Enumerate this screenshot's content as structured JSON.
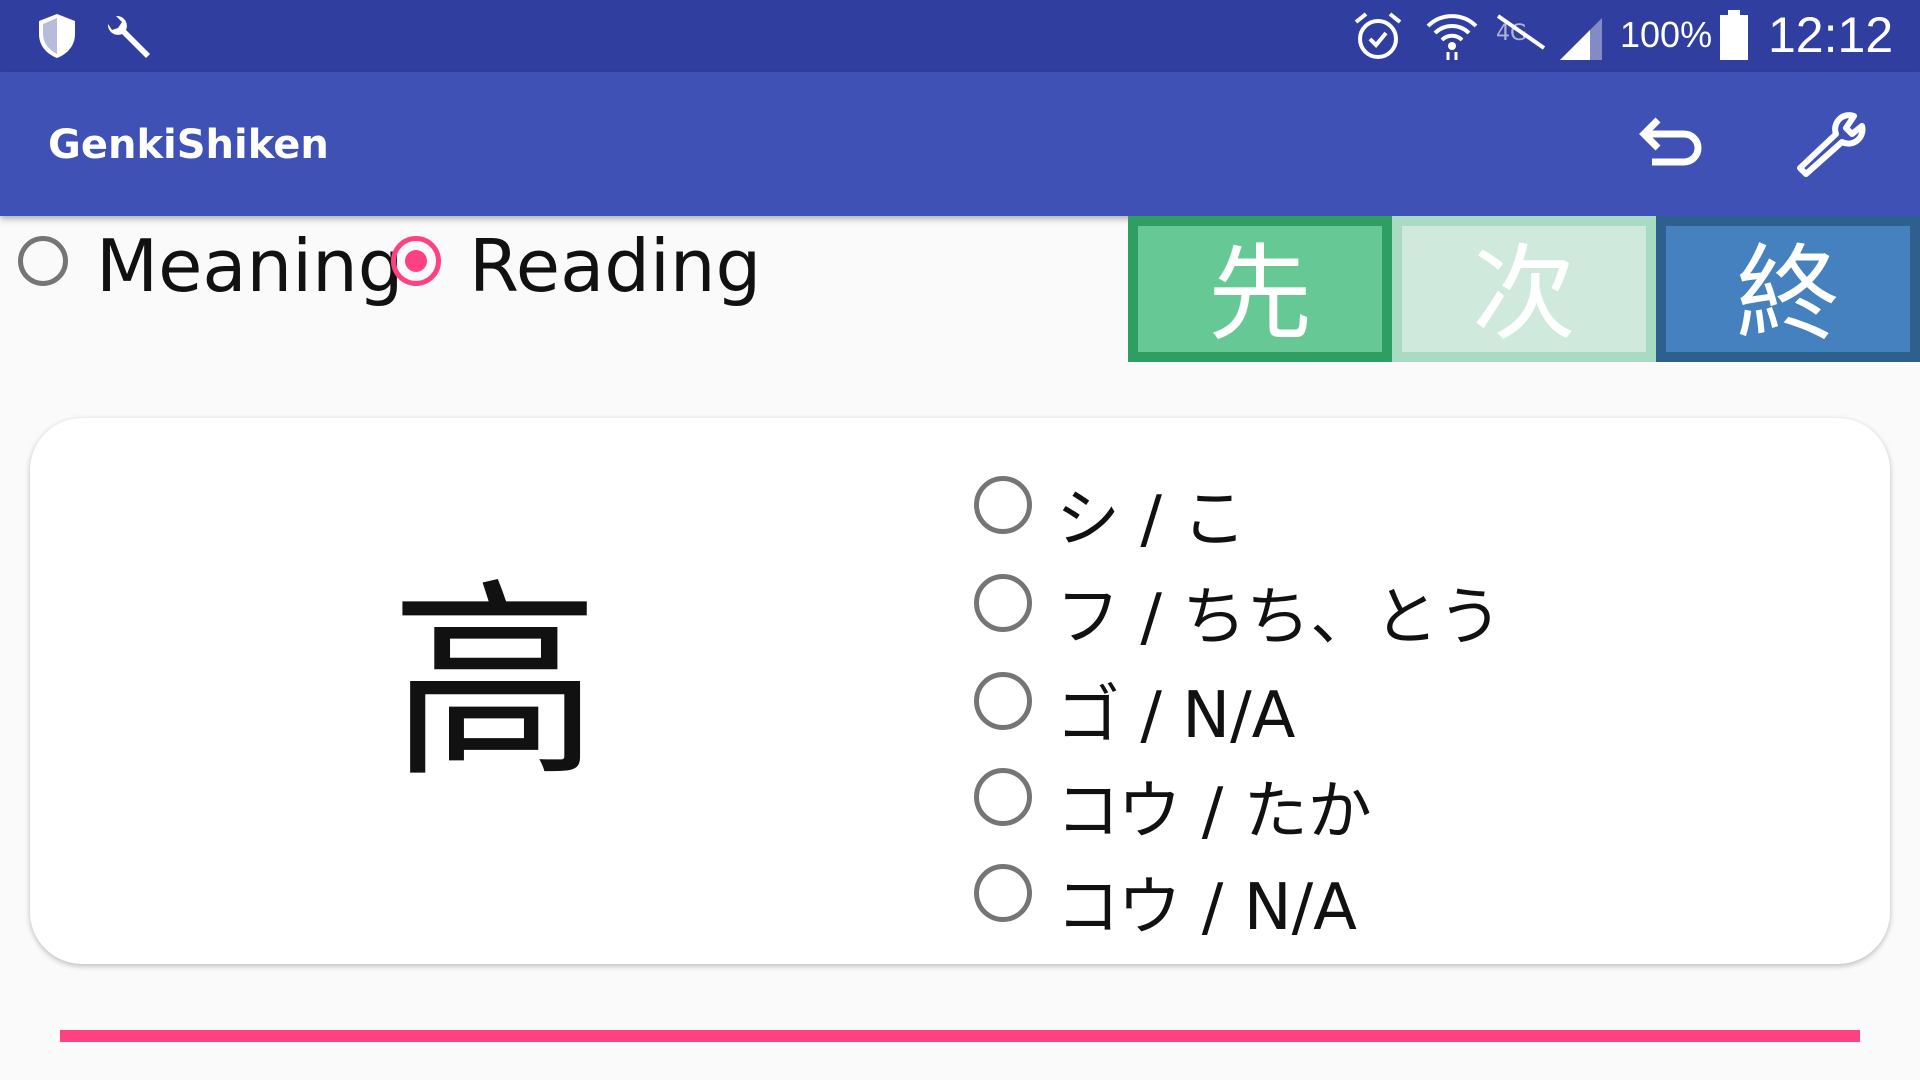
{
  "status_bar": {
    "battery_percent": "100%",
    "time": "12:12",
    "left_icons": [
      "shield-icon",
      "wrench-icon"
    ],
    "right_icons": [
      "alarm-icon",
      "wifi-icon",
      "mobile-data-off-icon",
      "cell-signal-icon",
      "battery-icon"
    ]
  },
  "app_bar": {
    "title": "GenkiShiken",
    "actions": [
      "undo-icon",
      "wrench-icon"
    ]
  },
  "mode": {
    "options": [
      {
        "label": "Meaning",
        "checked": false
      },
      {
        "label": "Reading",
        "checked": true
      }
    ]
  },
  "nav": {
    "first": {
      "label": "先",
      "bg": "#66c995",
      "border": "#2e9e63",
      "text": "#ffffff"
    },
    "next": {
      "label": "次",
      "bg": "#cfeadd",
      "border": "#a8dbc2",
      "text": "#ffffff"
    },
    "end": {
      "label": "終",
      "bg": "#4581be",
      "border": "#2f5f8f",
      "text": "#ffffff"
    }
  },
  "card": {
    "kanji": "高",
    "choices": [
      {
        "label": "シ / こ",
        "checked": false
      },
      {
        "label": "フ / ちち、とう",
        "checked": false
      },
      {
        "label": "ゴ / N/A",
        "checked": false
      },
      {
        "label": "コウ / たか",
        "checked": false
      },
      {
        "label": "コウ / N/A",
        "checked": false
      }
    ]
  },
  "progress": {
    "fraction": 1.0
  },
  "colors": {
    "status_bar": "#303f9f",
    "app_bar": "#3f51b5",
    "accent": "#ff4081"
  }
}
